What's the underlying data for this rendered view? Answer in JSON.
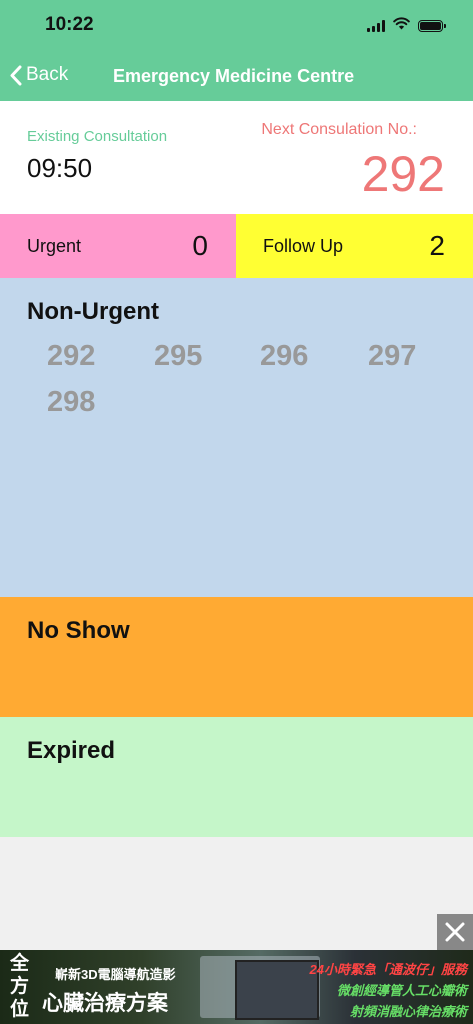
{
  "status_bar": {
    "time": "10:22"
  },
  "nav": {
    "back_label": "Back",
    "title": "Emergency Medicine Centre"
  },
  "consultation": {
    "existing_label": "Existing Consultation",
    "existing_time": "09:50",
    "next_label": "Next Consulation No.:",
    "next_number": "292"
  },
  "counts": {
    "urgent_label": "Urgent",
    "urgent_count": "0",
    "follow_up_label": "Follow Up",
    "follow_up_count": "2"
  },
  "sections": {
    "non_urgent_title": "Non-Urgent",
    "non_urgent_numbers": [
      "292",
      "295",
      "296",
      "297",
      "298"
    ],
    "no_show_title": "No Show",
    "expired_title": "Expired"
  },
  "ad": {
    "left_text": "全方位",
    "line1": "嶄新3D電腦導航造影",
    "line2": "心臟治療方案",
    "right1": "24小時緊急「通波仔」服務",
    "right2": "微創經導管人工心瓣術",
    "right3": "射頻消融心律治療術"
  },
  "icons": {
    "back": "chevron-left-icon",
    "signal": "signal-icon",
    "wifi": "wifi-icon",
    "battery": "battery-icon",
    "ad_close": "close-icon"
  },
  "colors": {
    "header": "#66cc99",
    "accent_text": "#66cc99",
    "next_number": "#ee7777",
    "urgent_bg": "#ff99cc",
    "follow_up_bg": "#ffff33",
    "non_urgent_bg": "#c2d7ec",
    "no_show_bg": "#ffaa33",
    "expired_bg": "#c5f6c9",
    "queue_number": "#999999"
  }
}
